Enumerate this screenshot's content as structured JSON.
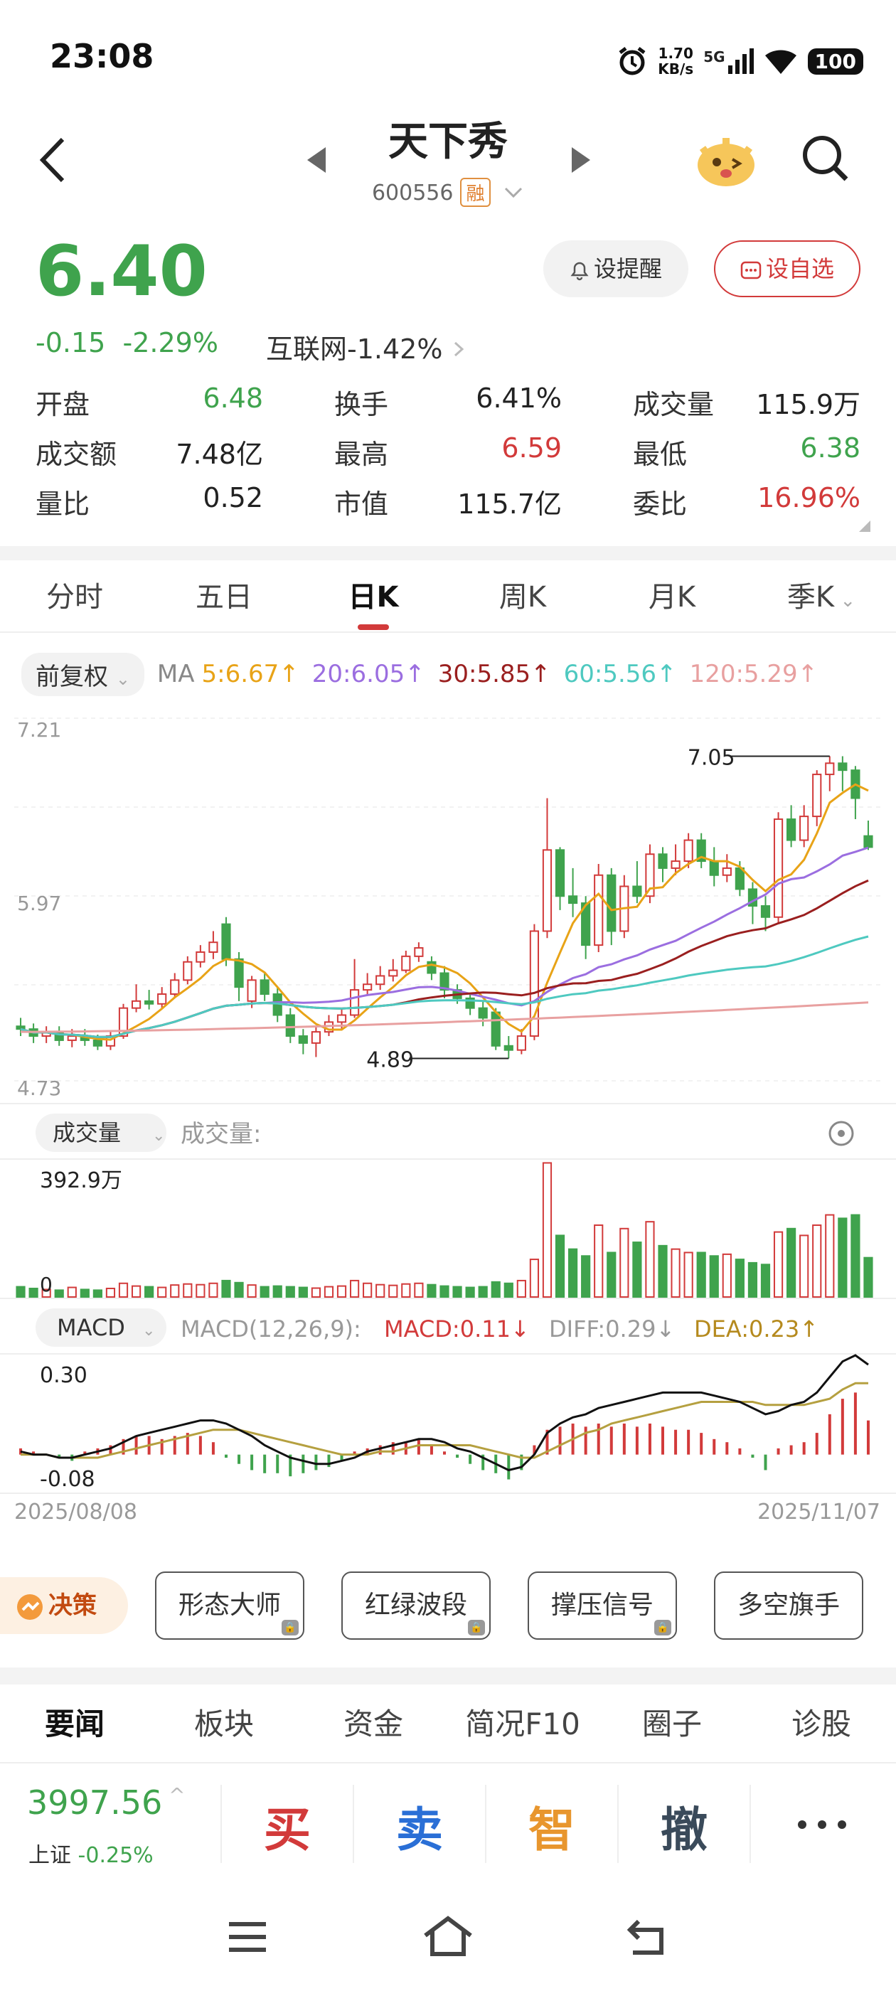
{
  "status": {
    "time": "23:08",
    "speed_top": "1.70",
    "speed_unit": "KB/s",
    "net": "5G",
    "battery": "100"
  },
  "header": {
    "name": "天下秀",
    "code": "600556",
    "rong": "融"
  },
  "quote": {
    "price": "6.40",
    "change": "-0.15",
    "change_pct": "-2.29%",
    "sector": "互联网-1.42%",
    "remind_label": "设提醒",
    "watch_label": "设自选"
  },
  "stats": [
    [
      {
        "l": "开盘",
        "v": "6.48",
        "c": "green"
      },
      {
        "l": "换手",
        "v": "6.41%",
        "c": "dark"
      },
      {
        "l": "成交量",
        "v": "115.9万",
        "c": "dark"
      }
    ],
    [
      {
        "l": "成交额",
        "v": "7.48亿",
        "c": "dark"
      },
      {
        "l": "最高",
        "v": "6.59",
        "c": "red"
      },
      {
        "l": "最低",
        "v": "6.38",
        "c": "green"
      }
    ],
    [
      {
        "l": "量比",
        "v": "0.52",
        "c": "dark"
      },
      {
        "l": "市值",
        "v": "115.7亿",
        "c": "dark"
      },
      {
        "l": "委比",
        "v": "16.96%",
        "c": "red"
      }
    ]
  ],
  "tabs": [
    "分时",
    "五日",
    "日K",
    "周K",
    "月K",
    "季K"
  ],
  "active_tab": 2,
  "ma": {
    "adjust": "前复权",
    "label": "MA",
    "ma5": "5:6.67↑",
    "ma20": "20:6.05↑",
    "ma30": "30:5.85↑",
    "ma60": "60:5.56↑",
    "ma120": "120:5.29↑",
    "colors": {
      "ma5": "#e8a317",
      "ma20": "#9b6ee0",
      "ma30": "#9a1f1f",
      "ma60": "#4ec9c0",
      "ma120": "#e8a0a0"
    }
  },
  "chart_data": {
    "type": "candlestick",
    "price_axis": {
      "top": "7.21",
      "mid": "5.97",
      "bottom": "4.73"
    },
    "max_label": "7.05",
    "min_label": "4.89",
    "volume_pill": "成交量",
    "volume_label": "成交量:",
    "volume_top": "392.9万",
    "volume_zero": "0",
    "macd_pill": "MACD",
    "macd_params": "MACD(12,26,9):",
    "macd_val": "MACD:0.11↓",
    "diff_val": "DIFF:0.29↓",
    "dea_val": "DEA:0.23↑",
    "macd_top": "0.30",
    "macd_bottom": "-0.08",
    "date_start": "2025/08/08",
    "date_end": "2025/11/07",
    "candles": [
      [
        5.12,
        5.1,
        5.18,
        5.05
      ],
      [
        5.1,
        5.05,
        5.14,
        5.0
      ],
      [
        5.05,
        5.08,
        5.12,
        5.0
      ],
      [
        5.08,
        5.02,
        5.12,
        4.98
      ],
      [
        5.02,
        5.05,
        5.1,
        4.97
      ],
      [
        5.05,
        5.02,
        5.1,
        4.98
      ],
      [
        5.02,
        4.98,
        5.06,
        4.95
      ],
      [
        4.98,
        5.05,
        5.08,
        4.95
      ],
      [
        5.05,
        5.25,
        5.28,
        5.03
      ],
      [
        5.25,
        5.3,
        5.42,
        5.22
      ],
      [
        5.3,
        5.28,
        5.38,
        5.24
      ],
      [
        5.28,
        5.35,
        5.4,
        5.25
      ],
      [
        5.35,
        5.45,
        5.5,
        5.32
      ],
      [
        5.45,
        5.58,
        5.62,
        5.42
      ],
      [
        5.58,
        5.65,
        5.7,
        5.54
      ],
      [
        5.65,
        5.72,
        5.8,
        5.6
      ],
      [
        5.85,
        5.6,
        5.9,
        5.55
      ],
      [
        5.6,
        5.4,
        5.65,
        5.3
      ],
      [
        5.3,
        5.45,
        5.48,
        5.25
      ],
      [
        5.45,
        5.35,
        5.5,
        5.3
      ],
      [
        5.35,
        5.2,
        5.4,
        5.15
      ],
      [
        5.2,
        5.05,
        5.25,
        5.0
      ],
      [
        5.05,
        5.0,
        5.1,
        4.92
      ],
      [
        5.0,
        5.08,
        5.12,
        4.9
      ],
      [
        5.08,
        5.15,
        5.2,
        5.05
      ],
      [
        5.15,
        5.2,
        5.25,
        5.1
      ],
      [
        5.2,
        5.38,
        5.6,
        5.18
      ],
      [
        5.38,
        5.42,
        5.5,
        5.34
      ],
      [
        5.42,
        5.48,
        5.55,
        5.38
      ],
      [
        5.48,
        5.52,
        5.6,
        5.44
      ],
      [
        5.52,
        5.62,
        5.66,
        5.5
      ],
      [
        5.62,
        5.68,
        5.72,
        5.58
      ],
      [
        5.58,
        5.5,
        5.62,
        5.45
      ],
      [
        5.5,
        5.38,
        5.55,
        5.32
      ],
      [
        5.38,
        5.32,
        5.42,
        5.28
      ],
      [
        5.32,
        5.25,
        5.36,
        5.2
      ],
      [
        5.25,
        5.18,
        5.3,
        5.12
      ],
      [
        5.22,
        4.98,
        5.25,
        4.95
      ],
      [
        4.98,
        4.95,
        5.05,
        4.89
      ],
      [
        4.95,
        5.05,
        5.1,
        4.92
      ],
      [
        5.05,
        5.8,
        5.85,
        5.02
      ],
      [
        5.8,
        6.38,
        6.75,
        5.75
      ],
      [
        6.38,
        6.05,
        6.4,
        5.95
      ],
      [
        6.05,
        6.0,
        6.25,
        5.9
      ],
      [
        6.0,
        5.7,
        6.05,
        5.6
      ],
      [
        5.7,
        6.2,
        6.28,
        5.65
      ],
      [
        6.2,
        5.8,
        6.25,
        5.7
      ],
      [
        5.8,
        6.12,
        6.2,
        5.75
      ],
      [
        6.12,
        6.05,
        6.3,
        6.0
      ],
      [
        6.05,
        6.35,
        6.42,
        6.0
      ],
      [
        6.35,
        6.25,
        6.4,
        6.15
      ],
      [
        6.25,
        6.3,
        6.42,
        6.2
      ],
      [
        6.3,
        6.45,
        6.5,
        6.25
      ],
      [
        6.45,
        6.3,
        6.5,
        6.25
      ],
      [
        6.3,
        6.2,
        6.4,
        6.12
      ],
      [
        6.2,
        6.25,
        6.35,
        6.15
      ],
      [
        6.25,
        6.1,
        6.3,
        6.05
      ],
      [
        6.1,
        5.98,
        6.15,
        5.85
      ],
      [
        5.98,
        5.9,
        6.05,
        5.8
      ],
      [
        5.9,
        6.6,
        6.65,
        5.85
      ],
      [
        6.6,
        6.45,
        6.7,
        6.4
      ],
      [
        6.45,
        6.62,
        6.7,
        6.4
      ],
      [
        6.62,
        6.92,
        6.95,
        6.55
      ],
      [
        6.92,
        7.0,
        7.05,
        6.8
      ],
      [
        7.0,
        6.95,
        7.05,
        6.8
      ],
      [
        6.95,
        6.75,
        6.98,
        6.6
      ],
      [
        6.48,
        6.4,
        6.59,
        6.38
      ]
    ],
    "volume": [
      30,
      25,
      22,
      20,
      28,
      22,
      20,
      25,
      40,
      32,
      30,
      28,
      35,
      38,
      36,
      40,
      48,
      42,
      35,
      30,
      32,
      30,
      28,
      26,
      30,
      32,
      48,
      40,
      36,
      34,
      38,
      40,
      36,
      32,
      30,
      28,
      30,
      44,
      40,
      48,
      110,
      392,
      180,
      140,
      120,
      210,
      130,
      200,
      160,
      220,
      150,
      140,
      130,
      130,
      120,
      125,
      110,
      100,
      95,
      190,
      200,
      180,
      210,
      240,
      230,
      240,
      115
    ],
    "macd_hist": [
      0.02,
      0.01,
      0.0,
      -0.01,
      -0.02,
      0.01,
      0.02,
      0.03,
      0.05,
      0.06,
      0.06,
      0.05,
      0.06,
      0.07,
      0.06,
      0.04,
      -0.01,
      -0.03,
      -0.05,
      -0.06,
      -0.06,
      -0.07,
      -0.06,
      -0.05,
      -0.04,
      -0.02,
      0.01,
      0.02,
      0.03,
      0.04,
      0.04,
      0.05,
      0.03,
      0.01,
      -0.01,
      -0.03,
      -0.05,
      -0.06,
      -0.08,
      -0.05,
      0.03,
      0.08,
      0.09,
      0.1,
      0.09,
      0.1,
      0.09,
      0.1,
      0.09,
      0.1,
      0.09,
      0.08,
      0.08,
      0.07,
      0.05,
      0.04,
      0.02,
      -0.01,
      -0.05,
      0.02,
      0.03,
      0.04,
      0.07,
      0.13,
      0.18,
      0.2,
      0.11
    ],
    "diff": [
      0.01,
      0.0,
      0.0,
      -0.01,
      -0.01,
      0.0,
      0.01,
      0.02,
      0.04,
      0.06,
      0.07,
      0.08,
      0.09,
      0.1,
      0.11,
      0.11,
      0.1,
      0.08,
      0.06,
      0.03,
      0.01,
      -0.01,
      -0.02,
      -0.03,
      -0.03,
      -0.02,
      -0.01,
      0.01,
      0.02,
      0.03,
      0.04,
      0.05,
      0.05,
      0.04,
      0.02,
      0.01,
      -0.01,
      -0.03,
      -0.05,
      -0.04,
      0.0,
      0.07,
      0.1,
      0.12,
      0.13,
      0.15,
      0.16,
      0.17,
      0.18,
      0.19,
      0.2,
      0.2,
      0.2,
      0.2,
      0.19,
      0.18,
      0.17,
      0.15,
      0.13,
      0.14,
      0.16,
      0.17,
      0.2,
      0.25,
      0.3,
      0.32,
      0.29
    ],
    "dea": [
      0.0,
      0.0,
      0.0,
      -0.01,
      -0.01,
      -0.01,
      -0.01,
      0.0,
      0.01,
      0.02,
      0.03,
      0.04,
      0.05,
      0.06,
      0.07,
      0.08,
      0.08,
      0.08,
      0.07,
      0.06,
      0.05,
      0.04,
      0.03,
      0.02,
      0.01,
      0.0,
      0.0,
      0.0,
      0.01,
      0.01,
      0.02,
      0.03,
      0.03,
      0.03,
      0.03,
      0.03,
      0.02,
      0.01,
      0.0,
      -0.01,
      -0.01,
      0.01,
      0.03,
      0.05,
      0.07,
      0.08,
      0.1,
      0.11,
      0.12,
      0.13,
      0.14,
      0.15,
      0.16,
      0.17,
      0.17,
      0.17,
      0.17,
      0.17,
      0.16,
      0.16,
      0.16,
      0.16,
      0.17,
      0.18,
      0.21,
      0.23,
      0.23
    ]
  },
  "tools": {
    "juece": "决策",
    "items": [
      "形态大师",
      "红绿波段",
      "撑压信号",
      "多空旗手"
    ]
  },
  "news_tabs": [
    "要闻",
    "板块",
    "资金",
    "简况F10",
    "圈子",
    "诊股"
  ],
  "bottom": {
    "index_value": "3997.56",
    "index_name": "上证",
    "index_pct": "-0.25%",
    "buy": "买",
    "sell": "卖",
    "smart": "智",
    "cancel": "撤"
  }
}
